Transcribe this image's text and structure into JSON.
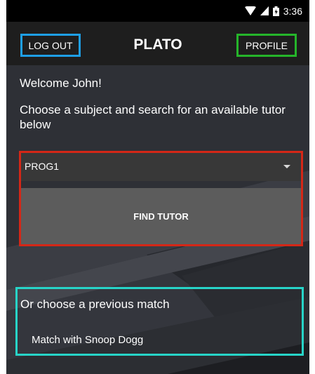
{
  "status_bar": {
    "time": "3:36",
    "icons": [
      "wifi-icon",
      "signal-icon",
      "battery-icon"
    ]
  },
  "header": {
    "logout_label": "LOG OUT",
    "title": "PLATO",
    "profile_label": "PROFILE"
  },
  "main": {
    "welcome": "Welcome John!",
    "instructions": "Choose a subject and search for an available tutor below",
    "subject_select": {
      "value": "PROG1"
    },
    "find_button": "FIND TUTOR",
    "previous_heading": "Or choose a previous match",
    "previous_matches": [
      "Match with Snoop Dogg"
    ]
  },
  "colors": {
    "logout_border": "#1e9fe6",
    "profile_border": "#25b52a",
    "subject_border": "#d42717",
    "previous_border": "#27d4c8"
  }
}
